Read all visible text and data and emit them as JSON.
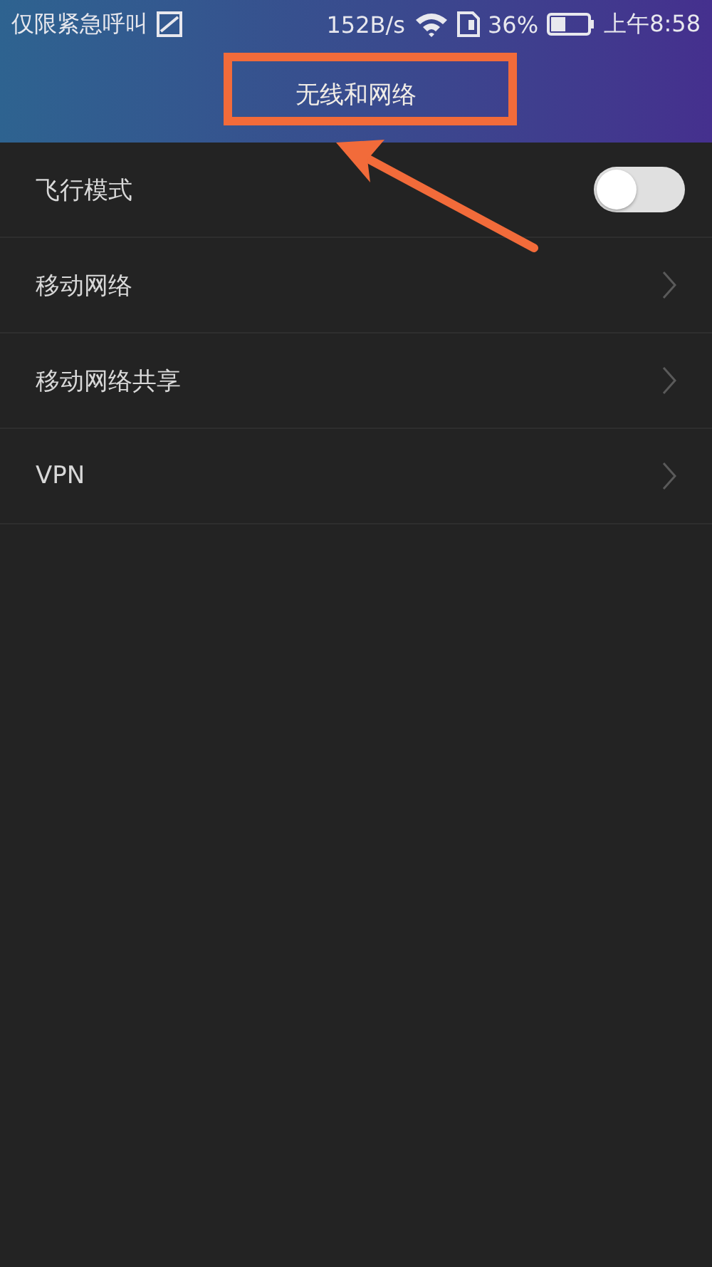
{
  "status_bar": {
    "carrier": "仅限紧急呼叫",
    "speed": "152B/s",
    "battery": "36%",
    "time": "上午8:58"
  },
  "header": {
    "title": "无线和网络",
    "highlighted": true
  },
  "items": [
    {
      "kind": "toggle",
      "label": "飞行模式",
      "on": false
    },
    {
      "kind": "link",
      "label": "移动网络"
    },
    {
      "kind": "link",
      "label": "移动网络共享"
    },
    {
      "kind": "link",
      "label": "VPN"
    }
  ]
}
